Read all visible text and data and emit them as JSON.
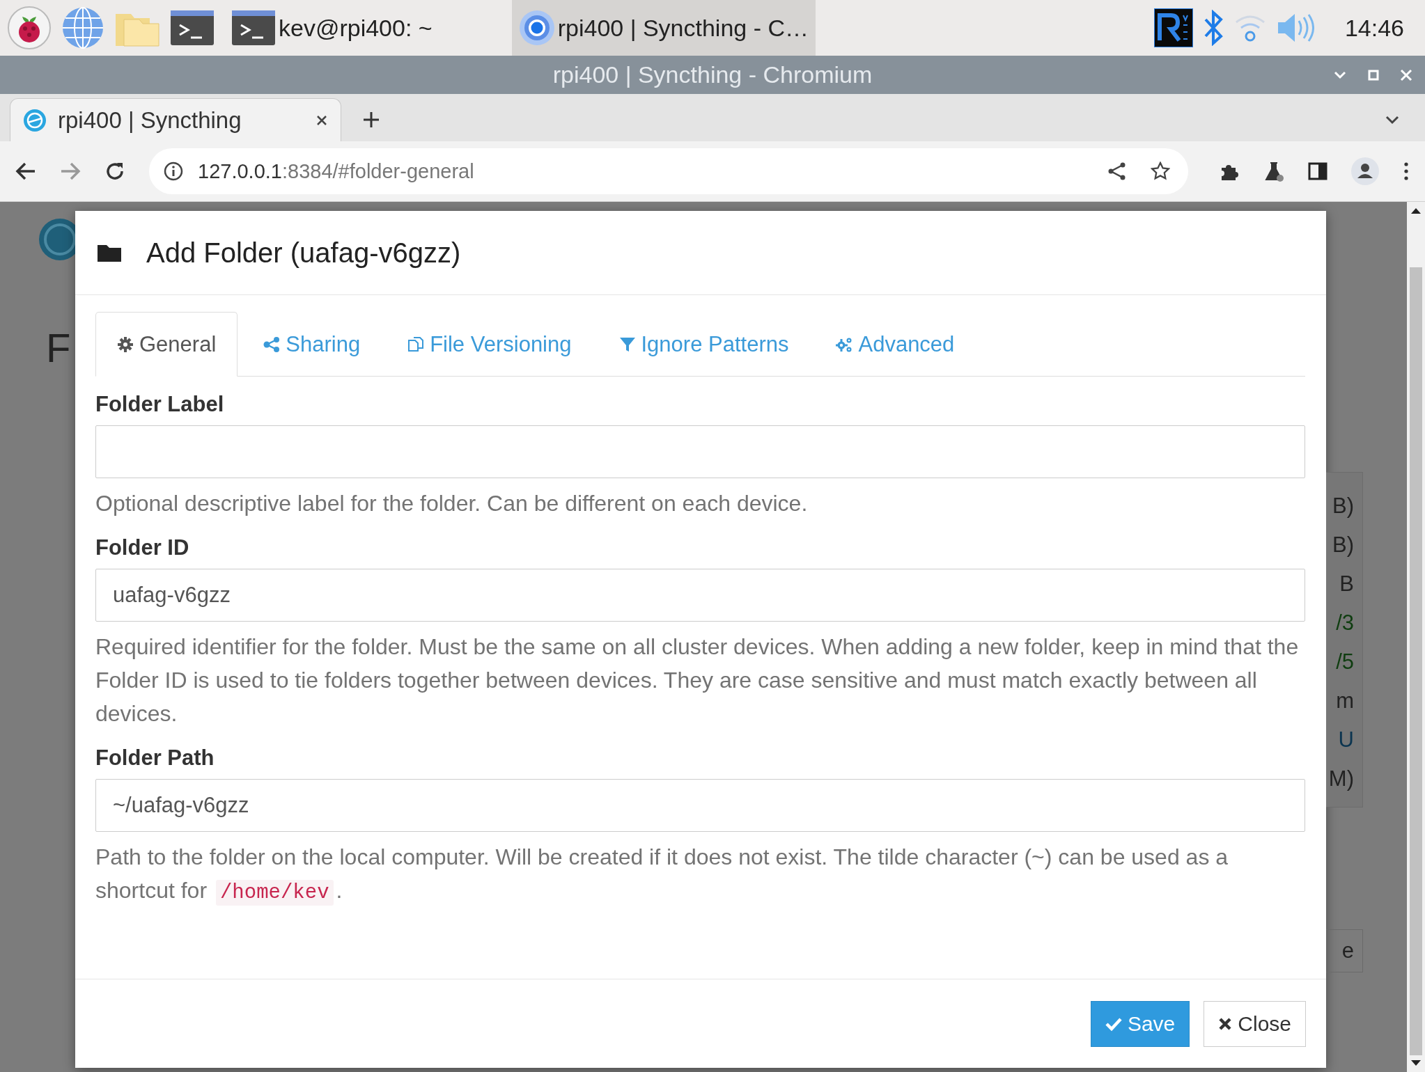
{
  "taskbar": {
    "windows": [
      {
        "kind": "terminal",
        "title": "kev@rpi400: ~",
        "selected": false
      },
      {
        "kind": "browser",
        "title": "rpi400 | Syncthing - C…",
        "selected": true
      }
    ],
    "clock": "14:46"
  },
  "window": {
    "title": "rpi400 | Syncthing - Chromium"
  },
  "browser_tabs": [
    {
      "label": "rpi400 | Syncthing",
      "selected": true
    }
  ],
  "address_bar": {
    "host": "127.0.0.1",
    "rest": ":8384/#folder-general"
  },
  "background_page": {
    "left_texts": [
      "F"
    ],
    "right_texts": [
      {
        "text": "B)",
        "color": "#222222"
      },
      {
        "text": "B)",
        "color": "#222222"
      },
      {
        "text": "B",
        "color": "#222222"
      },
      {
        "text": "/3",
        "color": "#0f3d10"
      },
      {
        "text": "/5",
        "color": "#0f3d10"
      },
      {
        "text": "m",
        "color": "#222222"
      },
      {
        "text": "U",
        "color": "#0c3550"
      },
      {
        "text": "M)",
        "color": "#222222"
      }
    ],
    "button_fragment": "e"
  },
  "modal": {
    "title": "Add Folder (uafag-v6gzz)",
    "tabs": [
      {
        "label": "General",
        "selected": true
      },
      {
        "label": "Sharing",
        "selected": false
      },
      {
        "label": "File Versioning",
        "selected": false
      },
      {
        "label": "Ignore Patterns",
        "selected": false
      },
      {
        "label": "Advanced",
        "selected": false
      }
    ],
    "fields": [
      {
        "label": "Folder Label",
        "help": [
          {
            "text": "Optional descriptive label for the folder. Can be different on each device."
          }
        ]
      },
      {
        "label": "Folder ID",
        "value": "uafag-v6gzz",
        "help": [
          {
            "text": "Required identifier for the folder. Must be the same on all cluster devices. When adding a new folder, keep in mind that the Folder ID is used to tie folders together between devices. They are case sensitive and must match exactly between all devices."
          }
        ]
      },
      {
        "label": "Folder Path",
        "value": "~/uafag-v6gzz",
        "help": [
          {
            "text": "Path to the folder on the local computer. Will be created if it does not exist. The tilde character (~) can be used as a shortcut for "
          },
          {
            "code": "/home/kev"
          },
          {
            "text": "."
          }
        ]
      }
    ],
    "buttons": [
      {
        "kind": "primary",
        "label": "Save"
      },
      {
        "kind": "default",
        "label": "Close"
      }
    ]
  }
}
